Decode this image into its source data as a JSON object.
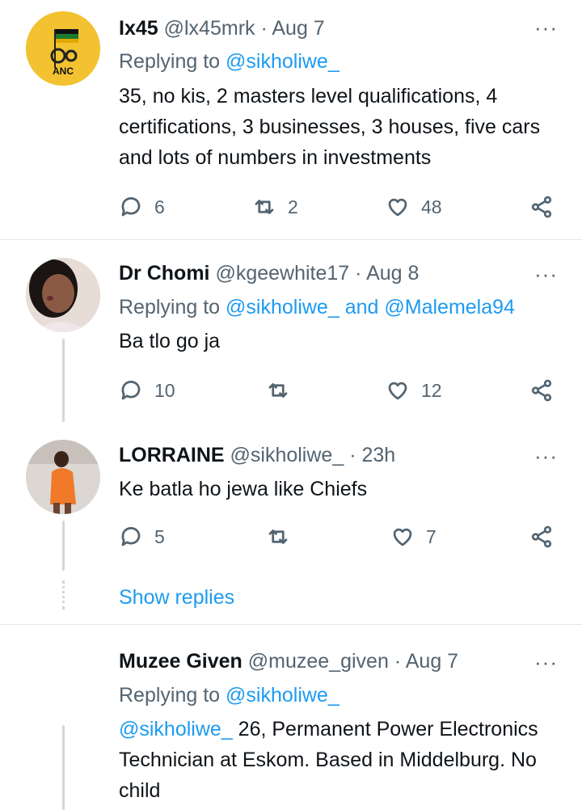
{
  "tweets": [
    {
      "name": "Ix45",
      "handle": "@lx45mrk",
      "dot": "·",
      "time": "Aug 7",
      "replying_prefix": "Replying to",
      "replying_to": "@sikholiwe_",
      "replying_and": "",
      "replying_to_2": "",
      "text": "35, no kis, 2 masters level qualifications, 4 certifications, 3 businesses, 3 houses, five cars and lots of numbers in investments",
      "replies": "6",
      "retweets": "2",
      "likes": "48",
      "avatar_label": "ANC"
    },
    {
      "name": "Dr Chomi",
      "handle": "@kgeewhite17",
      "dot": "·",
      "time": "Aug 8",
      "replying_prefix": "Replying to",
      "replying_to": "@sikholiwe_",
      "replying_and": "and",
      "replying_to_2": "@Malemela94",
      "text": "Ba tlo go ja",
      "replies": "10",
      "retweets": "",
      "likes": "12"
    },
    {
      "name": "LORRAINE",
      "handle": "@sikholiwe_",
      "dot": "·",
      "time": "23h",
      "text": "Ke batla ho jewa like Chiefs",
      "replies": "5",
      "retweets": "",
      "likes": "7"
    },
    {
      "name": "Muzee Given",
      "handle": "@muzee_given",
      "dot": "·",
      "time": "Aug 7",
      "replying_prefix": "Replying to",
      "replying_to": "@sikholiwe_",
      "mention": "@sikholiwe_",
      "text": " 26, Permanent Power Electronics Technician at Eskom. Based in Middelburg. No child"
    }
  ],
  "show_replies_label": "Show replies",
  "more_label": "···",
  "icons": [
    "reply-icon",
    "retweet-icon",
    "like-icon",
    "share-icon",
    "more-icon"
  ],
  "colors": {
    "link": "#1d9bf0",
    "secondary": "#536471",
    "anc_yellow": "#f2c230",
    "anc_green": "#1c7a2e"
  }
}
